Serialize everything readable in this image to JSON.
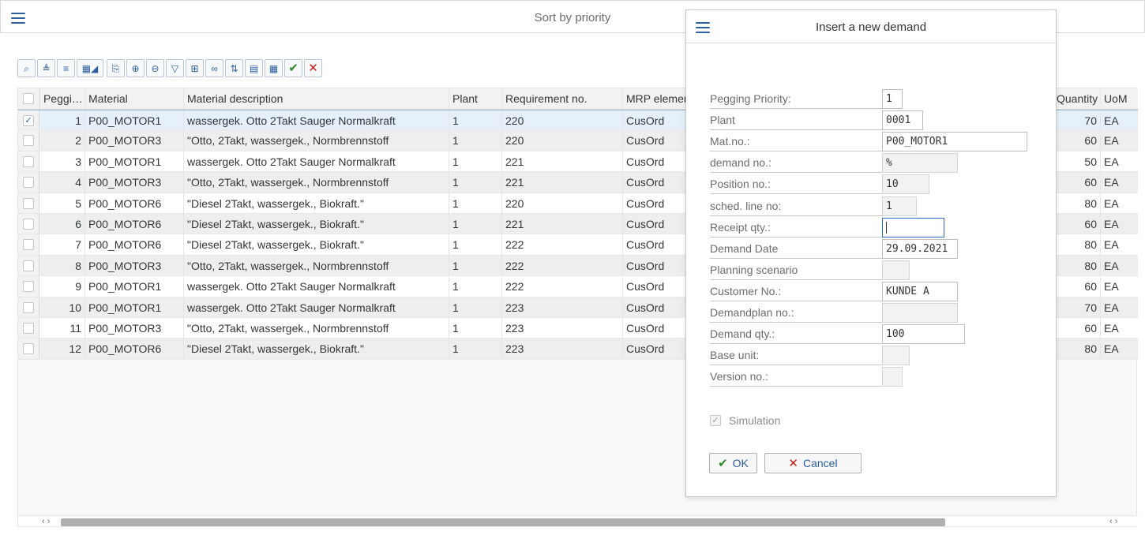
{
  "main": {
    "title": "Sort by priority"
  },
  "toolbar": {
    "buttons": [
      {
        "name": "zoom-details-icon",
        "glyph": "⌕"
      },
      {
        "name": "sort-ascending-icon",
        "glyph": "≜"
      },
      {
        "name": "sort-descending-icon",
        "glyph": "≡"
      },
      {
        "name": "layout-menu-icon",
        "glyph": "▦◢"
      },
      {
        "name": "copy-icon",
        "glyph": "⎘"
      },
      {
        "name": "expand-all-icon",
        "glyph": "⊕"
      },
      {
        "name": "collapse-all-icon",
        "glyph": "⊖"
      },
      {
        "name": "filter-icon",
        "glyph": "▽"
      },
      {
        "name": "hierarchy-icon",
        "glyph": "⊞"
      },
      {
        "name": "find-icon",
        "glyph": "∞"
      },
      {
        "name": "sort-order-icon",
        "glyph": "⇅"
      },
      {
        "name": "columns-icon",
        "glyph": "▤"
      },
      {
        "name": "settings-grid-icon",
        "glyph": "▦"
      },
      {
        "name": "accept-icon",
        "glyph": "✔"
      },
      {
        "name": "reject-icon",
        "glyph": "✕"
      }
    ]
  },
  "grid": {
    "headers": {
      "pegging": "Peggi…",
      "material": "Material",
      "description": "Material description",
      "plant": "Plant",
      "requirement": "Requirement no.",
      "mrp": "MRP elemen",
      "quantity": "Quantity",
      "uom": "UoM"
    },
    "rows": [
      {
        "pegging": "1",
        "material": "P00_MOTOR1",
        "description": "wassergek. Otto 2Takt Sauger Normalkraft",
        "plant": "1",
        "requirement": "220",
        "mrp": "CusOrd",
        "quantity": "70",
        "uom": "EA",
        "checked": "✓"
      },
      {
        "pegging": "2",
        "material": "P00_MOTOR3",
        "description": "\"Otto, 2Takt, wassergek., Normbrennstoff",
        "plant": "1",
        "requirement": "220",
        "mrp": "CusOrd",
        "quantity": "60",
        "uom": "EA",
        "checked": ""
      },
      {
        "pegging": "3",
        "material": "P00_MOTOR1",
        "description": "wassergek. Otto 2Takt Sauger Normalkraft",
        "plant": "1",
        "requirement": "221",
        "mrp": "CusOrd",
        "quantity": "50",
        "uom": "EA",
        "checked": ""
      },
      {
        "pegging": "4",
        "material": "P00_MOTOR3",
        "description": "\"Otto, 2Takt, wassergek., Normbrennstoff",
        "plant": "1",
        "requirement": "221",
        "mrp": "CusOrd",
        "quantity": "60",
        "uom": "EA",
        "checked": ""
      },
      {
        "pegging": "5",
        "material": "P00_MOTOR6",
        "description": "\"Diesel 2Takt, wassergek., Biokraft.\"",
        "plant": "1",
        "requirement": "220",
        "mrp": "CusOrd",
        "quantity": "80",
        "uom": "EA",
        "checked": ""
      },
      {
        "pegging": "6",
        "material": "P00_MOTOR6",
        "description": "\"Diesel 2Takt, wassergek., Biokraft.\"",
        "plant": "1",
        "requirement": "221",
        "mrp": "CusOrd",
        "quantity": "60",
        "uom": "EA",
        "checked": ""
      },
      {
        "pegging": "7",
        "material": "P00_MOTOR6",
        "description": "\"Diesel 2Takt, wassergek., Biokraft.\"",
        "plant": "1",
        "requirement": "222",
        "mrp": "CusOrd",
        "quantity": "80",
        "uom": "EA",
        "checked": ""
      },
      {
        "pegging": "8",
        "material": "P00_MOTOR3",
        "description": "\"Otto, 2Takt, wassergek., Normbrennstoff",
        "plant": "1",
        "requirement": "222",
        "mrp": "CusOrd",
        "quantity": "80",
        "uom": "EA",
        "checked": ""
      },
      {
        "pegging": "9",
        "material": "P00_MOTOR1",
        "description": "wassergek. Otto 2Takt Sauger Normalkraft",
        "plant": "1",
        "requirement": "222",
        "mrp": "CusOrd",
        "quantity": "60",
        "uom": "EA",
        "checked": ""
      },
      {
        "pegging": "10",
        "material": "P00_MOTOR1",
        "description": "wassergek. Otto 2Takt Sauger Normalkraft",
        "plant": "1",
        "requirement": "223",
        "mrp": "CusOrd",
        "quantity": "70",
        "uom": "EA",
        "checked": ""
      },
      {
        "pegging": "11",
        "material": "P00_MOTOR3",
        "description": "\"Otto, 2Takt, wassergek., Normbrennstoff",
        "plant": "1",
        "requirement": "223",
        "mrp": "CusOrd",
        "quantity": "60",
        "uom": "EA",
        "checked": ""
      },
      {
        "pegging": "12",
        "material": "P00_MOTOR6",
        "description": "\"Diesel 2Takt, wassergek., Biokraft.\"",
        "plant": "1",
        "requirement": "223",
        "mrp": "CusOrd",
        "quantity": "80",
        "uom": "EA",
        "checked": ""
      }
    ],
    "scroll_left": "‹ ›",
    "scroll_right": "‹ ›"
  },
  "dialog": {
    "title": "Insert a new demand",
    "fields": [
      {
        "name": "pegging-priority",
        "label": "Pegging Priority:",
        "value": "1",
        "readonly": false
      },
      {
        "name": "plant",
        "label": "Plant",
        "value": "0001",
        "readonly": false
      },
      {
        "name": "mat-no",
        "label": "Mat.no.:",
        "value": "P00_MOTOR1",
        "readonly": false
      },
      {
        "name": "demand-no",
        "label": "demand no.:",
        "value": "%",
        "readonly": true
      },
      {
        "name": "position-no",
        "label": "Position no.:",
        "value": "10",
        "readonly": true
      },
      {
        "name": "sched-line-no",
        "label": "sched. line no:",
        "value": "1",
        "readonly": true
      },
      {
        "name": "receipt-qty",
        "label": "Receipt qty.:",
        "value": "",
        "readonly": false
      },
      {
        "name": "demand-date",
        "label": "Demand Date",
        "value": "29.09.2021",
        "readonly": false
      },
      {
        "name": "planning-scenario",
        "label": "Planning scenario",
        "value": "",
        "readonly": true
      },
      {
        "name": "customer-no",
        "label": "Customer No.:",
        "value": "KUNDE A",
        "readonly": false
      },
      {
        "name": "demandplan-no",
        "label": "Demandplan no.:",
        "value": "",
        "readonly": true
      },
      {
        "name": "demand-qty",
        "label": "Demand qty.:",
        "value": "100",
        "readonly": false
      },
      {
        "name": "base-unit",
        "label": "Base unit:",
        "value": "",
        "readonly": true
      },
      {
        "name": "version-no",
        "label": "Version no.:",
        "value": "",
        "readonly": true
      }
    ],
    "simulation": {
      "label": "Simulation",
      "checked": "✓"
    },
    "ok_label": "OK",
    "ok_icon": "✔",
    "cancel_label": "Cancel",
    "cancel_icon": "✕"
  }
}
